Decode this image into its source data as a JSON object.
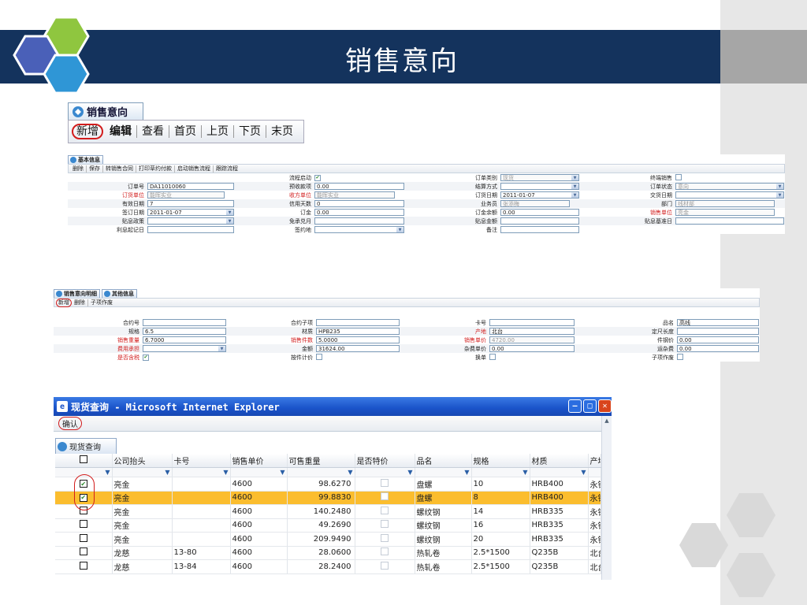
{
  "slide": {
    "title": "销售意向"
  },
  "top_toolbar": {
    "tab_label": "销售意向",
    "items": [
      "新增",
      "编辑",
      "查看",
      "首页",
      "上页",
      "下页",
      "末页"
    ]
  },
  "basic_panel": {
    "tab_label": "基本信息",
    "actions": [
      "删除",
      "保存",
      "转销售合同",
      "打印草约付款",
      "启动销售流程",
      "跟踪流程"
    ],
    "rows": [
      [
        {
          "label": "",
          "value": ""
        },
        {
          "label": "流程启动",
          "value": "☑"
        },
        {
          "label": "订单类别",
          "value": "现货"
        },
        {
          "label": "终端销售",
          "value": "☐"
        }
      ],
      [
        {
          "label": "订单号",
          "value": "DA11010060"
        },
        {
          "label": "预收款项",
          "value": "0.00"
        },
        {
          "label": "结算方式",
          "value": ""
        },
        {
          "label": "订单状态",
          "value": "意向"
        }
      ],
      [
        {
          "label": "订货单位",
          "value": "能晖实业"
        },
        {
          "label": "收方单位",
          "value": "能晖实业"
        },
        {
          "label": "订货日期",
          "value": "2011-01-07"
        },
        {
          "label": "交货日期",
          "value": ""
        }
      ],
      [
        {
          "label": "有效日期",
          "value": "7"
        },
        {
          "label": "信用天数",
          "value": "0"
        },
        {
          "label": "业务员",
          "value": "张添梅"
        },
        {
          "label": "部门",
          "value": "线材部"
        }
      ],
      [
        {
          "label": "签订日期",
          "value": "2011-01-07"
        },
        {
          "label": "订金",
          "value": "0.00"
        },
        {
          "label": "订金余额",
          "value": "0.00"
        },
        {
          "label": "销售单位",
          "value": "亮金"
        }
      ],
      [
        {
          "label": "贴息政策",
          "value": ""
        },
        {
          "label": "免承兑月",
          "value": ""
        },
        {
          "label": "贴息金额",
          "value": ""
        },
        {
          "label": "贴息基准日",
          "value": ""
        }
      ],
      [
        {
          "label": "利息起记日",
          "value": ""
        },
        {
          "label": "签约地",
          "value": ""
        },
        {
          "label": "备注",
          "value": ""
        },
        {
          "label": "",
          "value": ""
        }
      ]
    ]
  },
  "detail_panel": {
    "tabs": [
      "销售意向明细",
      "其他信息"
    ],
    "actions": [
      "新增",
      "删除",
      "子项作废"
    ],
    "rows": [
      [
        {
          "label": "合约号",
          "value": ""
        },
        {
          "label": "合约子项",
          "value": ""
        },
        {
          "label": "卡号",
          "value": ""
        },
        {
          "label": "品名",
          "value": "高线"
        }
      ],
      [
        {
          "label": "规格",
          "value": "6.5"
        },
        {
          "label": "材质",
          "value": "HPB235"
        },
        {
          "label": "产地",
          "value": "北台"
        },
        {
          "label": "定尺长度",
          "value": ""
        }
      ],
      [
        {
          "label": "销售重量",
          "value": "6.7000"
        },
        {
          "label": "销售件数",
          "value": "5.0000"
        },
        {
          "label": "销售单价",
          "value": "4720.00"
        },
        {
          "label": "件钢价",
          "value": "0.00"
        }
      ],
      [
        {
          "label": "费用承担",
          "value": ""
        },
        {
          "label": "金额",
          "value": "31624.00"
        },
        {
          "label": "杂费单价",
          "value": "0.00"
        },
        {
          "label": "运杂费",
          "value": "0.00"
        }
      ],
      [
        {
          "label": "是否含税",
          "value": "☑"
        },
        {
          "label": "按件计价",
          "value": "☐"
        },
        {
          "label": "换单",
          "value": "☐"
        },
        {
          "label": "子项作废",
          "value": "☐"
        }
      ]
    ]
  },
  "ie_window": {
    "title": "现货查询 - Microsoft Internet Explorer",
    "confirm_label": "确认",
    "tab_label": "现货查询",
    "columns": [
      "",
      "公司抬头",
      "卡号",
      "销售单价",
      "可售重量",
      "是否特价",
      "品名",
      "规格",
      "材质",
      "产地"
    ],
    "rows": [
      {
        "checked": true,
        "selected": false,
        "cells": [
          "亮金",
          "",
          "4600",
          "98.6270",
          "",
          "盘螺",
          "10",
          "HRB400",
          "永钢"
        ]
      },
      {
        "checked": true,
        "selected": true,
        "cells": [
          "亮金",
          "",
          "4600",
          "99.8830",
          "",
          "盘螺",
          "8",
          "HRB400",
          "永钢"
        ]
      },
      {
        "checked": false,
        "selected": false,
        "cells": [
          "亮金",
          "",
          "4600",
          "140.2480",
          "",
          "螺纹钢",
          "14",
          "HRB335",
          "永钢"
        ]
      },
      {
        "checked": false,
        "selected": false,
        "cells": [
          "亮金",
          "",
          "4600",
          "49.2690",
          "",
          "螺纹钢",
          "16",
          "HRB335",
          "永钢"
        ]
      },
      {
        "checked": false,
        "selected": false,
        "cells": [
          "亮金",
          "",
          "4600",
          "209.9490",
          "",
          "螺纹钢",
          "20",
          "HRB335",
          "永钢"
        ]
      },
      {
        "checked": false,
        "selected": false,
        "cells": [
          "龙慈",
          "13-80",
          "4600",
          "28.0600",
          "",
          "热轧卷",
          "2.5*1500",
          "Q235B",
          "北台"
        ]
      },
      {
        "checked": false,
        "selected": false,
        "cells": [
          "龙慈",
          "13-84",
          "4600",
          "28.2400",
          "",
          "热轧卷",
          "2.5*1500",
          "Q235B",
          "北台"
        ]
      }
    ]
  },
  "colors": {
    "banner": "#14335d",
    "selected_row": "#fbbd2e",
    "annotation": "#d21c1c"
  }
}
